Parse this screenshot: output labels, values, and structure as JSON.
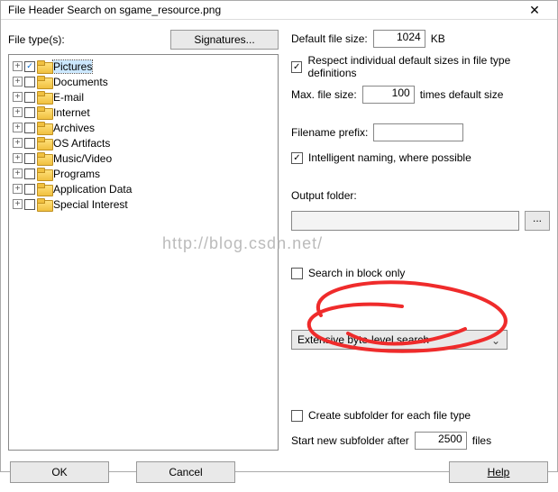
{
  "title": "File Header Search on sgame_resource.png",
  "left": {
    "label": "File type(s):",
    "signatures_btn": "Signatures...",
    "items": [
      {
        "label": "Pictures",
        "checked": true
      },
      {
        "label": "Documents",
        "checked": false
      },
      {
        "label": "E-mail",
        "checked": false
      },
      {
        "label": "Internet",
        "checked": false
      },
      {
        "label": "Archives",
        "checked": false
      },
      {
        "label": "OS Artifacts",
        "checked": false
      },
      {
        "label": "Music/Video",
        "checked": false
      },
      {
        "label": "Programs",
        "checked": false
      },
      {
        "label": "Application Data",
        "checked": false
      },
      {
        "label": "Special Interest",
        "checked": false
      }
    ]
  },
  "right": {
    "default_size_label": "Default file size:",
    "default_size_value": "1024",
    "default_size_unit": "KB",
    "respect_individual": {
      "checked": true,
      "label": "Respect individual default sizes in file type definitions"
    },
    "max_size_label": "Max. file size:",
    "max_size_value": "100",
    "max_size_suffix": "times default size",
    "prefix_label": "Filename prefix:",
    "prefix_value": "",
    "intelligent_naming": {
      "checked": true,
      "label": "Intelligent naming, where possible"
    },
    "output_label": "Output folder:",
    "output_value": "",
    "output_browse": "...",
    "search_block": {
      "checked": false,
      "label": "Search in block only"
    },
    "dropdown_value": "Extensive byte-level search",
    "create_subfolder": {
      "checked": false,
      "label": "Create subfolder for each file type"
    },
    "new_subfolder_label": "Start new subfolder after",
    "new_subfolder_value": "2500",
    "new_subfolder_unit": "files"
  },
  "buttons": {
    "ok": "OK",
    "cancel": "Cancel",
    "help": "Help"
  },
  "watermark": "http://blog.csdn.net/"
}
